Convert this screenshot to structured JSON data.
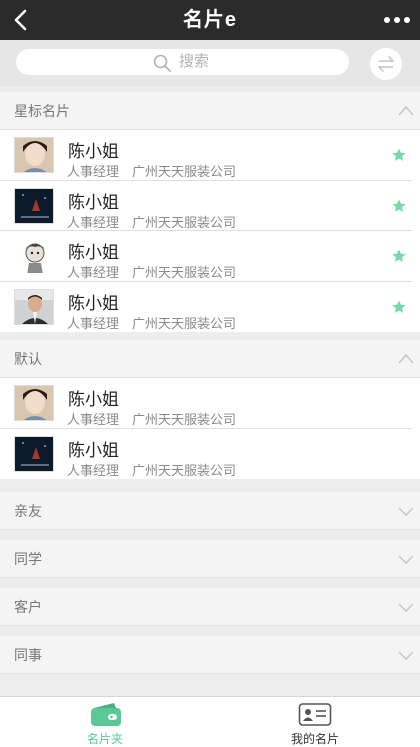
{
  "header": {
    "title": "名片e",
    "back_icon": "back-arrow-icon",
    "more_icon": "more-dots-icon"
  },
  "search": {
    "placeholder": "搜索",
    "icon": "search-icon",
    "swap_icon": "swap-arrows-icon"
  },
  "colors": {
    "accent": "#5ac994",
    "navbar": "#2b2b2b",
    "star": "#73dba3"
  },
  "groups": [
    {
      "title": "星标名片",
      "expanded": true,
      "cards": [
        {
          "name": "陈小姐",
          "role": "人事经理",
          "company": "广州天天服装公司",
          "starred": true,
          "avatar": "photo-girl"
        },
        {
          "name": "陈小姐",
          "role": "人事经理",
          "company": "广州天天服装公司",
          "starred": true,
          "avatar": "dark-landscape"
        },
        {
          "name": "陈小姐",
          "role": "人事经理",
          "company": "广州天天服装公司",
          "starred": true,
          "avatar": "cartoon-character"
        },
        {
          "name": "陈小姐",
          "role": "人事经理",
          "company": "广州天天服装公司",
          "starred": true,
          "avatar": "photo-man"
        }
      ]
    },
    {
      "title": "默认",
      "expanded": true,
      "cards": [
        {
          "name": "陈小姐",
          "role": "人事经理",
          "company": "广州天天服装公司",
          "starred": false,
          "avatar": "photo-girl"
        },
        {
          "name": "陈小姐",
          "role": "人事经理",
          "company": "广州天天服装公司",
          "starred": false,
          "avatar": "dark-landscape"
        }
      ]
    },
    {
      "title": "亲友",
      "expanded": false,
      "cards": []
    },
    {
      "title": "同学",
      "expanded": false,
      "cards": []
    },
    {
      "title": "客户",
      "expanded": false,
      "cards": []
    },
    {
      "title": "同事",
      "expanded": false,
      "cards": []
    }
  ],
  "tabbar": {
    "tabs": [
      {
        "label": "名片夹",
        "icon": "card-holder-icon",
        "active": true
      },
      {
        "label": "我的名片",
        "icon": "my-card-icon",
        "active": false
      }
    ]
  }
}
